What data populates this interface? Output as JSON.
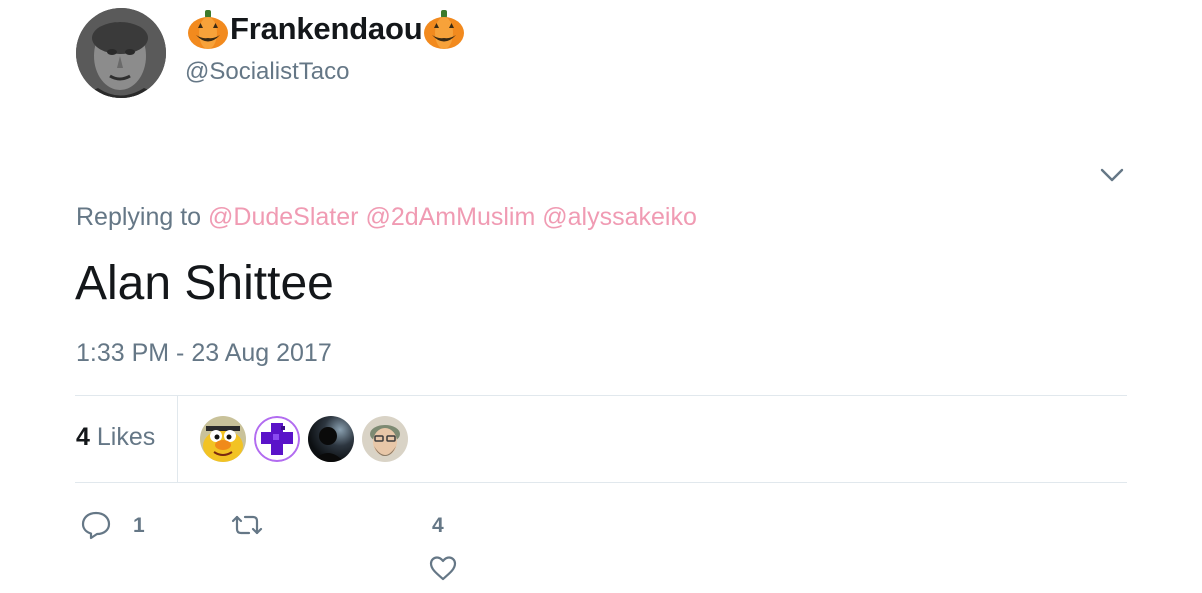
{
  "user": {
    "display_name": "Frankendaou",
    "handle": "@SocialistTaco",
    "avatar_icon": "grayscale-face-portrait",
    "name_emoji": "pumpkin-icon"
  },
  "tweet": {
    "replying_prefix": "Replying to",
    "mentions": [
      "@DudeSlater",
      "@2dAmMuslim",
      "@alyssakeiko"
    ],
    "text": "Alan Shittee",
    "timestamp": "1:33 PM - 23 Aug 2017"
  },
  "stats": {
    "likes_number": "4",
    "likes_label": "Likes",
    "likers": [
      {
        "icon": "bert-muppet-avatar"
      },
      {
        "icon": "purple-cross-avatar"
      },
      {
        "icon": "dark-silhouette-avatar"
      },
      {
        "icon": "bearded-man-avatar"
      }
    ]
  },
  "actions": {
    "reply_count": "1",
    "retweet_count": "",
    "like_count": "4"
  },
  "colors": {
    "mention": "#f09bb3",
    "secondary_text": "#657786",
    "primary_text": "#14171a",
    "divider": "#e1e8ed"
  }
}
